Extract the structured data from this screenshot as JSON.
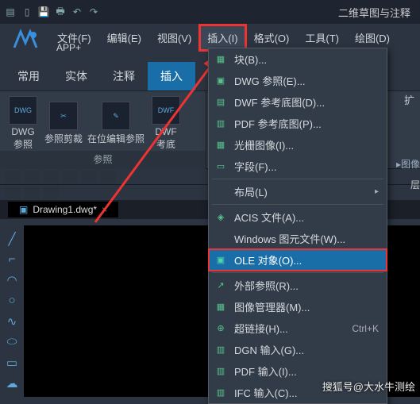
{
  "titlebar": {
    "mode": "二维草图与注释"
  },
  "menubar": {
    "items": [
      {
        "label": "文件(F)"
      },
      {
        "label": "编辑(E)"
      },
      {
        "label": "视图(V)"
      },
      {
        "label": "插入(I)"
      },
      {
        "label": "格式(O)"
      },
      {
        "label": "工具(T)"
      },
      {
        "label": "绘图(D)"
      }
    ],
    "appplus": "APP+"
  },
  "ribbonTabs": [
    {
      "label": "常用"
    },
    {
      "label": "实体"
    },
    {
      "label": "注释"
    },
    {
      "label": "插入"
    }
  ],
  "ribbon": {
    "group1": {
      "label": "参照",
      "items": [
        {
          "label": "DWG\n参照",
          "ic": "DWG"
        },
        {
          "label": "参照剪裁",
          "ic": "✂"
        },
        {
          "label": "在位编辑参照",
          "ic": "✎"
        },
        {
          "label": "DWF\n考底",
          "ic": "DWF"
        }
      ]
    }
  },
  "rightFrag": {
    "a": "扩",
    "image": "▸图像",
    "layer": "层"
  },
  "fileTab": {
    "name": "Drawing1.dwg*"
  },
  "dropdown": [
    {
      "label": "块(B)...",
      "icon": "▦"
    },
    {
      "label": "DWG 参照(E)...",
      "icon": "▣"
    },
    {
      "label": "DWF 参考底图(D)...",
      "icon": "▤"
    },
    {
      "label": "PDF 参考底图(P)...",
      "icon": "▥"
    },
    {
      "label": "光栅图像(I)...",
      "icon": "▦"
    },
    {
      "label": "字段(F)...",
      "icon": "▭"
    },
    {
      "sep": true
    },
    {
      "label": "布局(L)",
      "arrow": "▸",
      "icon": ""
    },
    {
      "sep": true
    },
    {
      "label": "ACIS 文件(A)...",
      "icon": "◈"
    },
    {
      "label": "Windows 图元文件(W)...",
      "icon": ""
    },
    {
      "label": "OLE 对象(O)...",
      "icon": "▣",
      "hl": true
    },
    {
      "sep": true
    },
    {
      "label": "外部参照(R)...",
      "icon": "↗"
    },
    {
      "label": "图像管理器(M)...",
      "icon": "▦"
    },
    {
      "label": "超链接(H)...",
      "shortcut": "Ctrl+K",
      "icon": "⊕"
    },
    {
      "label": "DGN 输入(G)...",
      "icon": "▥"
    },
    {
      "label": "PDF 输入(I)...",
      "icon": "▥"
    },
    {
      "label": "IFC 输入(C)...",
      "icon": "▥"
    }
  ],
  "watermark": "搜狐号@大水牛测绘"
}
